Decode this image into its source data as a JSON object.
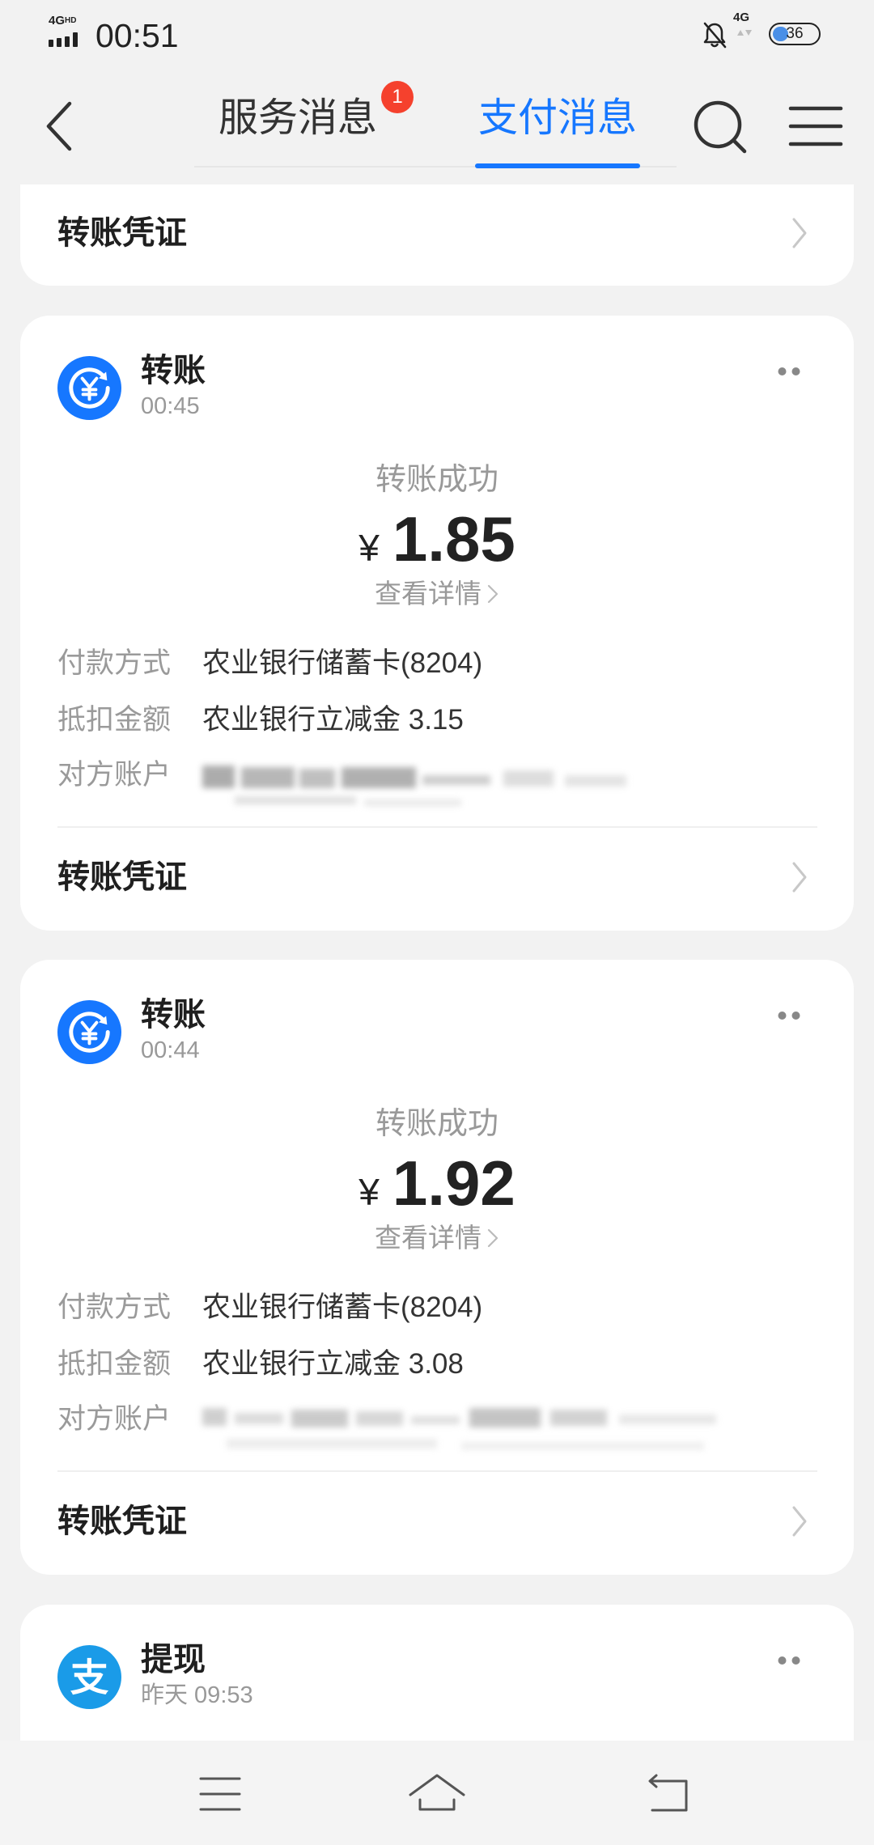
{
  "status_bar": {
    "network_type": "4G",
    "network_hd": "HD",
    "time": "00:51",
    "mobile_data": "4G",
    "battery": "36",
    "icons": {
      "signal": "signal-bars-icon",
      "mute": "bell-off-icon",
      "battery": "battery-icon"
    }
  },
  "header": {
    "tabs": [
      {
        "label": "服务消息",
        "badge": "1",
        "active": false
      },
      {
        "label": "支付消息",
        "active": true
      }
    ],
    "icons": {
      "back": "chevron-left-icon",
      "search": "search-icon",
      "menu": "menu-icon"
    }
  },
  "colors": {
    "accent": "#1677ff",
    "badge": "#f5412d",
    "page_background": "#f2f2f2",
    "card_background": "#ffffff",
    "alipay_blue": "#1a9be8"
  },
  "previous_card": {
    "voucher_label": "转账凭证"
  },
  "messages": [
    {
      "icon": "transfer-yuan-icon",
      "title": "转账",
      "time": "00:45",
      "status": "转账成功",
      "currency": "¥",
      "amount": "1.85",
      "detail_link": "查看详情",
      "rows": [
        {
          "label": "付款方式",
          "value": "农业银行储蓄卡(8204)"
        },
        {
          "label": "抵扣金额",
          "value": "农业银行立减金 3.15"
        },
        {
          "label": "对方账户",
          "redacted": true
        }
      ],
      "voucher_label": "转账凭证"
    },
    {
      "icon": "transfer-yuan-icon",
      "title": "转账",
      "time": "00:44",
      "status": "转账成功",
      "currency": "¥",
      "amount": "1.92",
      "detail_link": "查看详情",
      "rows": [
        {
          "label": "付款方式",
          "value": "农业银行储蓄卡(8204)"
        },
        {
          "label": "抵扣金额",
          "value": "农业银行立减金 3.08"
        },
        {
          "label": "对方账户",
          "redacted": true
        }
      ],
      "voucher_label": "转账凭证"
    },
    {
      "icon": "alipay-icon",
      "logo_char": "支",
      "title": "提现",
      "time": "昨天 09:53"
    }
  ],
  "bottom_nav": {
    "icons": [
      "menu-lines-icon",
      "home-icon",
      "back-arrow-icon"
    ]
  }
}
